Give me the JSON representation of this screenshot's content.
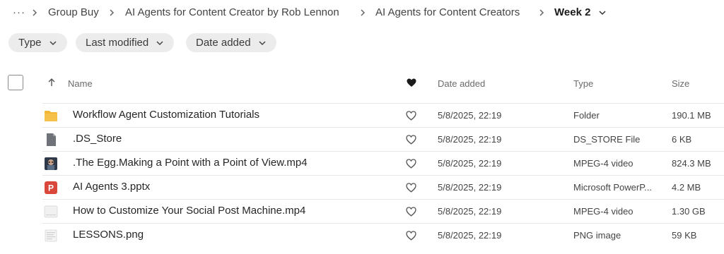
{
  "breadcrumb": {
    "more": "···",
    "items": [
      "Group Buy",
      "AI Agents for Content Creator by Rob Lennon",
      "AI Agents for Content Creators"
    ],
    "current": "Week 2"
  },
  "filters": [
    {
      "label": "Type"
    },
    {
      "label": "Last modified"
    },
    {
      "label": "Date added"
    }
  ],
  "table": {
    "columns": {
      "name": "Name",
      "date_added": "Date added",
      "type": "Type",
      "size": "Size"
    },
    "rows": [
      {
        "icon": "folder-icon",
        "name": "Workflow Agent Customization Tutorials",
        "date": "5/8/2025, 22:19",
        "type": "Folder",
        "size": "190.1 MB"
      },
      {
        "icon": "generic-file-icon",
        "name": ".DS_Store",
        "date": "5/8/2025, 22:19",
        "type": "DS_STORE File",
        "size": "6 KB"
      },
      {
        "icon": "video-thumbnail-icon",
        "name": ".The Egg.Making a Point with a Point of View.mp4",
        "date": "5/8/2025, 22:19",
        "type": "MPEG-4 video",
        "size": "824.3 MB"
      },
      {
        "icon": "powerpoint-icon",
        "name": "AI Agents 3.pptx",
        "date": "5/8/2025, 22:19",
        "type": "Microsoft PowerP...",
        "size": "4.2 MB"
      },
      {
        "icon": "video-file-icon",
        "name": "How to Customize Your Social Post Machine.mp4",
        "date": "5/8/2025, 22:19",
        "type": "MPEG-4 video",
        "size": "1.30 GB"
      },
      {
        "icon": "image-file-icon",
        "name": "LESSONS.png",
        "date": "5/8/2025, 22:19",
        "type": "PNG image",
        "size": "59 KB"
      }
    ]
  },
  "colors": {
    "folder": "#f2b632",
    "generic_file": "#6f7379",
    "powerpoint": "#d9473a",
    "chip_bg": "#ececec",
    "row_border": "#e6e6e6"
  }
}
